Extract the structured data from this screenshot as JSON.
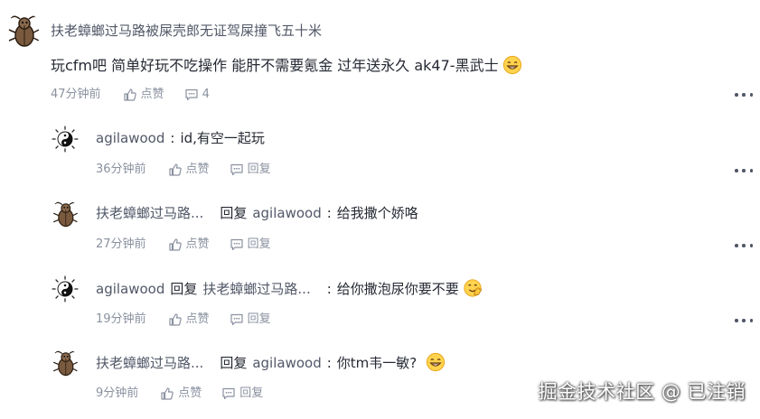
{
  "main_comment": {
    "author": "扶老蟑螂过马路被屎壳郎无证驾屎撞飞五十米",
    "content": "玩cfm吧 简单好玩不吃操作 能肝不需要氪金 过年送永久 ak47-黑武士",
    "content_emoji": "grin-emoji",
    "time": "47分钟前",
    "like_label": "点赞",
    "comment_count": "4"
  },
  "replies": [
    {
      "author": "agilawood",
      "reply_word": "",
      "reply_to": "",
      "colon": ":",
      "content": "id,有空一起玩",
      "time": "36分钟前",
      "like_label": "点赞",
      "reply_label": "回复",
      "avatar": "yin-yang-avatar"
    },
    {
      "author": "扶老蟑螂过马路...",
      "reply_word": "回复",
      "reply_to": "agilawood",
      "colon": ":",
      "content": "给我撒个娇咯",
      "time": "27分钟前",
      "like_label": "点赞",
      "reply_label": "回复",
      "avatar": "bug-avatar"
    },
    {
      "author": "agilawood",
      "reply_word": "回复",
      "reply_to": "扶老蟑螂过马路...",
      "colon": ":",
      "content": "给你撒泡尿你要不要",
      "time": "19分钟前",
      "like_label": "点赞",
      "reply_label": "回复",
      "avatar": "yin-yang-avatar"
    },
    {
      "author": "扶老蟑螂过马路...",
      "reply_word": "回复",
      "reply_to": "agilawood",
      "colon": ":",
      "content": "你tm韦一敏?",
      "time": "9分钟前",
      "like_label": "点赞",
      "reply_label": "回复",
      "avatar": "bug-avatar"
    }
  ],
  "watermark": "掘金技术社区 @ 已注销",
  "colors": {
    "text_primary": "#252933",
    "text_secondary": "#515767",
    "text_meta": "#8a919f"
  }
}
